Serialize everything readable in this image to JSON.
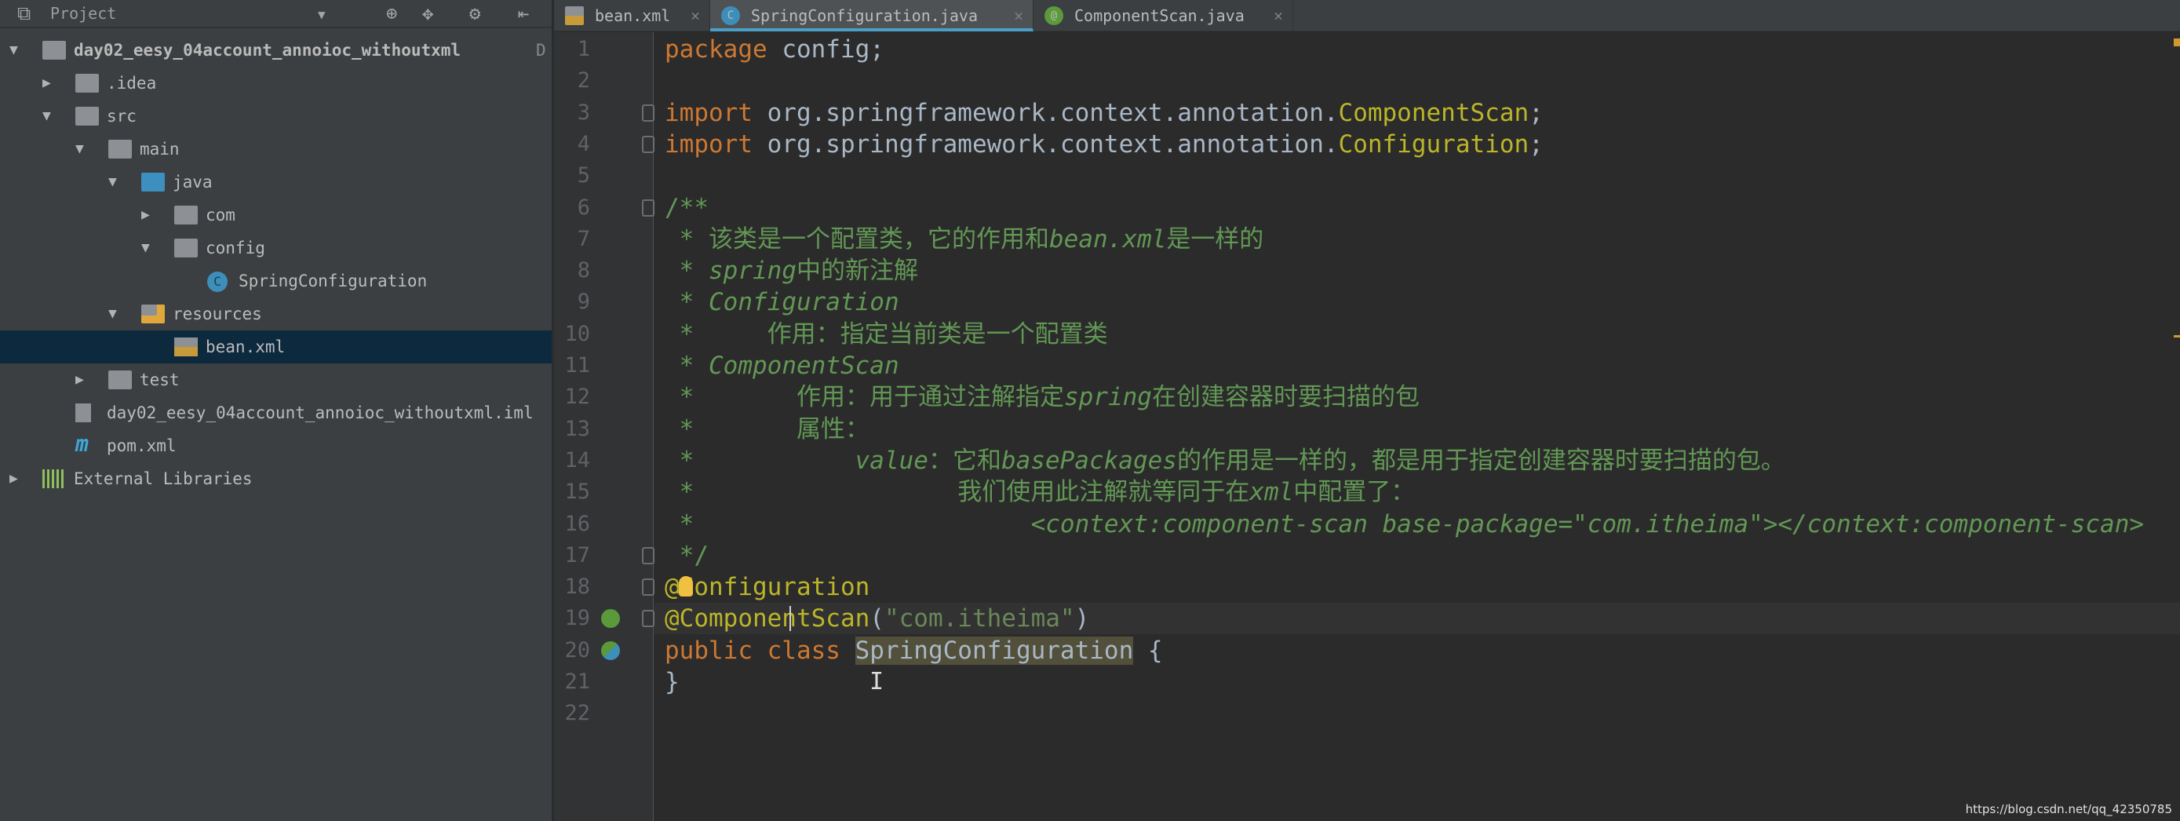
{
  "sidebar": {
    "title": "Project",
    "tree": [
      {
        "label": "day02_eesy_04account_annoioc_withoutxml",
        "suffix": "D",
        "level": 0,
        "arrow": "down",
        "icon": "module-folder-icon"
      },
      {
        "label": ".idea",
        "level": 1,
        "arrow": "right",
        "icon": "folder-icon"
      },
      {
        "label": "src",
        "level": 1,
        "arrow": "down",
        "icon": "folder-icon"
      },
      {
        "label": "main",
        "level": 2,
        "arrow": "down",
        "icon": "folder-icon"
      },
      {
        "label": "java",
        "level": 3,
        "arrow": "down",
        "icon": "source-folder-icon"
      },
      {
        "label": "com",
        "level": 4,
        "arrow": "right",
        "icon": "package-icon"
      },
      {
        "label": "config",
        "level": 4,
        "arrow": "down",
        "icon": "package-icon"
      },
      {
        "label": "SpringConfiguration",
        "level": 5,
        "arrow": "",
        "icon": "class-icon"
      },
      {
        "label": "resources",
        "level": 3,
        "arrow": "down",
        "icon": "resources-folder-icon"
      },
      {
        "label": "bean.xml",
        "level": 4,
        "arrow": "",
        "icon": "xml-file-icon",
        "selected": true
      },
      {
        "label": "test",
        "level": 2,
        "arrow": "right",
        "icon": "folder-icon"
      },
      {
        "label": "day02_eesy_04account_annoioc_withoutxml.iml",
        "level": 1,
        "arrow": "",
        "icon": "iml-file-icon"
      },
      {
        "label": "pom.xml",
        "level": 1,
        "arrow": "",
        "icon": "maven-icon"
      },
      {
        "label": "External Libraries",
        "level": 0,
        "arrow": "right",
        "icon": "library-icon"
      }
    ]
  },
  "tabs": [
    {
      "label": "bean.xml",
      "icon": "xml-file-icon",
      "active": false
    },
    {
      "label": "SpringConfiguration.java",
      "icon": "class-icon",
      "active": true
    },
    {
      "label": "ComponentScan.java",
      "icon": "annotation-icon",
      "active": false
    }
  ],
  "code": [
    [
      [
        "package",
        "kw"
      ],
      [
        " config;",
        ""
      ]
    ],
    [],
    [
      [
        "import",
        "kw"
      ],
      [
        " org.springframework.context.annotation.",
        ""
      ],
      [
        "ComponentScan",
        "an"
      ],
      [
        ";",
        ""
      ]
    ],
    [
      [
        "import",
        "kw"
      ],
      [
        " org.springframework.context.annotation.",
        ""
      ],
      [
        "Configuration",
        "an"
      ],
      [
        ";",
        ""
      ]
    ],
    [],
    [
      [
        "/**",
        "cm"
      ]
    ],
    [
      [
        " * 该类是一个配置类，它的作用和",
        "cm"
      ],
      [
        "bean.xml",
        "cmi"
      ],
      [
        "是一样的",
        "cm"
      ]
    ],
    [
      [
        " * ",
        "cm"
      ],
      [
        "spring",
        "cmi"
      ],
      [
        "中的新注解",
        "cm"
      ]
    ],
    [
      [
        " * ",
        "cm"
      ],
      [
        "Configuration",
        "cmi"
      ]
    ],
    [
      [
        " *     作用：指定当前类是一个配置类",
        "cm"
      ]
    ],
    [
      [
        " * ",
        "cm"
      ],
      [
        "ComponentScan",
        "cmi"
      ]
    ],
    [
      [
        " *       作用：用于通过注解指定",
        "cm"
      ],
      [
        "spring",
        "cmi"
      ],
      [
        "在创建容器时要扫描的包",
        "cm"
      ]
    ],
    [
      [
        " *       属性：",
        "cm"
      ]
    ],
    [
      [
        " *           ",
        "cm"
      ],
      [
        "value",
        "cmi"
      ],
      [
        "：它和",
        "cm"
      ],
      [
        "basePackages",
        "cmi"
      ],
      [
        "的作用是一样的，都是用于指定创建容器时要扫描的包。",
        "cm"
      ]
    ],
    [
      [
        " *                  我们使用此注解就等同于在",
        "cm"
      ],
      [
        "xml",
        "cmi"
      ],
      [
        "中配置了：",
        "cm"
      ]
    ],
    [
      [
        " *                       ",
        "cm"
      ],
      [
        "<context:component-scan base-package=\"com.itheima\"></context:component-scan>",
        "cmi"
      ]
    ],
    [
      [
        " */",
        "cm"
      ]
    ],
    [
      [
        "@Configuration",
        "an"
      ]
    ],
    [
      [
        "@ComponentScan",
        "an"
      ],
      [
        "(",
        ""
      ],
      [
        "\"com.itheima\"",
        "str"
      ],
      [
        ")",
        ""
      ]
    ],
    [
      [
        "public class ",
        "kw"
      ],
      [
        "SpringConfiguration",
        "hl"
      ],
      [
        " {",
        ""
      ]
    ],
    [
      [
        "}",
        ""
      ]
    ],
    []
  ],
  "current_line": 19,
  "watermark": "https://blog.csdn.net/qq_42350785",
  "colors": {
    "keyword": "#cc7832",
    "annotation": "#bbb529",
    "string": "#6a8759",
    "doc_comment": "#629755",
    "accent": "#4a9fc9"
  }
}
